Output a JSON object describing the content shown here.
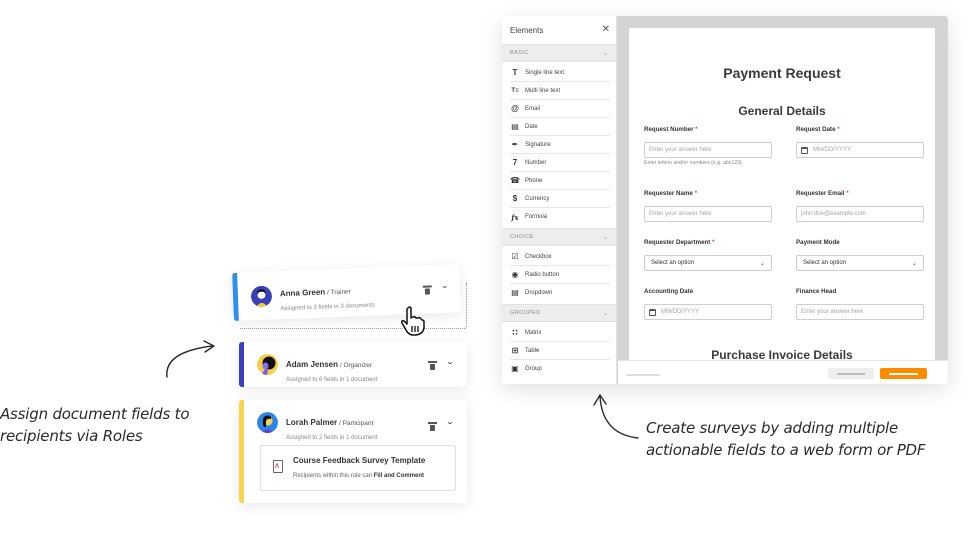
{
  "elements_panel": {
    "title": "Elements",
    "close_icon": "close-icon",
    "sections": [
      {
        "label": "BASIC",
        "items": [
          {
            "icon": "text-icon",
            "glyph": "T",
            "label": "Single line text"
          },
          {
            "icon": "multiline-text-icon",
            "glyph": "T≡",
            "label": "Multi line text"
          },
          {
            "icon": "at-icon",
            "glyph": "@",
            "label": "Email"
          },
          {
            "icon": "calendar-icon",
            "glyph": "▤",
            "label": "Date"
          },
          {
            "icon": "pen-icon",
            "glyph": "✒",
            "label": "Signature"
          },
          {
            "icon": "number-icon",
            "glyph": "7",
            "label": "Number"
          },
          {
            "icon": "phone-icon",
            "glyph": "☎",
            "label": "Phone"
          },
          {
            "icon": "dollar-icon",
            "glyph": "$",
            "label": "Currency"
          },
          {
            "icon": "formula-icon",
            "glyph": "fx",
            "label": "Formula"
          }
        ]
      },
      {
        "label": "CHOICE",
        "items": [
          {
            "icon": "checkbox-icon",
            "glyph": "☑",
            "label": "Checkbox"
          },
          {
            "icon": "radio-icon",
            "glyph": "◉",
            "label": "Radio button"
          },
          {
            "icon": "dropdown-icon",
            "glyph": "▤",
            "label": "Dropdown"
          }
        ]
      },
      {
        "label": "GROUPED",
        "items": [
          {
            "icon": "matrix-icon",
            "glyph": "∷",
            "label": "Matrix"
          },
          {
            "icon": "table-icon",
            "glyph": "⊞",
            "label": "Table"
          },
          {
            "icon": "group-icon",
            "glyph": "▣",
            "label": "Group"
          }
        ]
      }
    ]
  },
  "form": {
    "title": "Payment Request",
    "section1": "General Details",
    "section2": "Purchase Invoice Details",
    "fields": [
      {
        "label": "Request Number",
        "required": "*",
        "type": "text",
        "placeholder": "Enter your answer here",
        "help": "Enter letters and/or numbers (e.g. abc123)"
      },
      {
        "label": "Request Date",
        "required": "*",
        "type": "date",
        "placeholder": "MM/DD/YYYY"
      },
      {
        "label": "Requester Name",
        "required": "*",
        "type": "text",
        "placeholder": "Enter your answer here"
      },
      {
        "label": "Requester Email",
        "required": "*",
        "type": "text",
        "placeholder": "john.doe@example.com"
      },
      {
        "label": "Requester Department",
        "required": "*",
        "type": "select",
        "value": "Select an option"
      },
      {
        "label": "Payment Mode",
        "required": "",
        "type": "select",
        "value": "Select an option"
      },
      {
        "label": "Accounting Date",
        "required": "",
        "type": "date",
        "placeholder": "MM/DD/YYYY"
      },
      {
        "label": "Finance Head",
        "required": "",
        "type": "text",
        "placeholder": "Enter your answer here"
      }
    ],
    "colors": {
      "accent": "#ff8c00",
      "required": "#e04b4b"
    }
  },
  "roles": [
    {
      "name": "Anna Green",
      "role": "Trainer",
      "summary": "Assigned to 3 fields in 3 documents",
      "stripe": "#2f8ef0",
      "avatar_bg": "#3b3fb8"
    },
    {
      "name": "Adam Jensen",
      "role": "Organizer",
      "summary": "Assigned to 6 fields in 1 document",
      "stripe": "#3a3fbf",
      "avatar_bg": "#f6cf4a"
    },
    {
      "name": "Lorah Palmer",
      "role": "Participant",
      "summary": "Assigned to 2 fields in 1 document",
      "stripe": "#f8d44c",
      "avatar_bg": "#2d86e6",
      "document": {
        "title": "Course Feedback Survey Template",
        "permission_prefix": "Recipients within this role can",
        "permission": "Fill and Comment"
      }
    }
  ],
  "annotations": {
    "left": [
      "Assign document fields to",
      "recipients via Roles"
    ],
    "right": [
      "Create surveys by adding multiple",
      "actionable fields to a web form or PDF"
    ]
  }
}
